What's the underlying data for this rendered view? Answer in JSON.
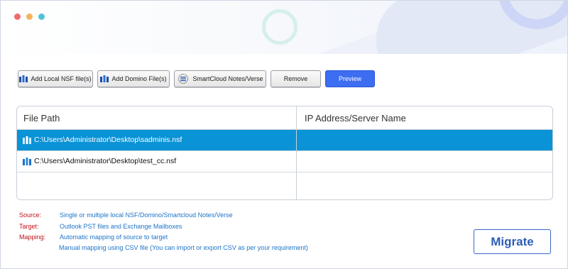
{
  "window": {
    "dots": [
      {
        "name": "close",
        "color": "#f06b6b"
      },
      {
        "name": "minimize",
        "color": "#f4b45c"
      },
      {
        "name": "maximize",
        "color": "#4fc3d9"
      }
    ]
  },
  "toolbar": {
    "add_local_label": "Add Local NSF file(s)",
    "add_domino_label": "Add Domino File(s)",
    "smartcloud_label": "SmartCloud Notes/Verse",
    "remove_label": "Remove",
    "preview_label": "Preview"
  },
  "table": {
    "columns": [
      "File Path",
      "IP Address/Server Name"
    ],
    "rows": [
      {
        "path": "C:\\Users\\Administrator\\Desktop\\sadminis.nsf",
        "server": "",
        "selected": true
      },
      {
        "path": "C:\\Users\\Administrator\\Desktop\\test_cc.nsf",
        "server": "",
        "selected": false
      }
    ]
  },
  "info": {
    "source_label": "Source:",
    "source_value": "Single or multiple local NSF/Domino/Smartcloud Notes/Verse",
    "target_label": "Target:",
    "target_value": "Outlook PST files and Exchange Mailboxes",
    "mapping_label": "Mapping:",
    "mapping_value_1": "Automatic mapping of source to target",
    "mapping_value_2": "Manual mapping using CSV file (You can import or export CSV as per your requirement)"
  },
  "actions": {
    "migrate_label": "Migrate"
  },
  "colors": {
    "accent": "#3d6df0",
    "selection": "#0a93d6",
    "label_red": "#c0121a",
    "value_blue": "#1d74c7"
  }
}
